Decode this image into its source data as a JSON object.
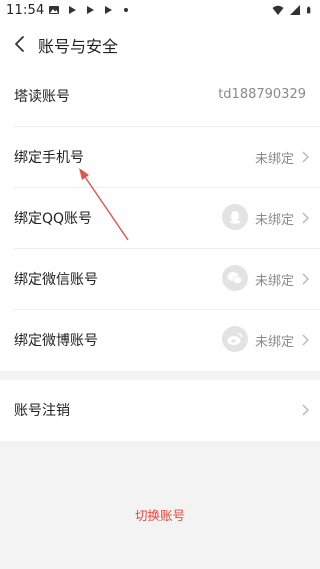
{
  "status_bar": {
    "time": "11:54",
    "left_icons": [
      "image-icon",
      "play-icon",
      "play-icon",
      "play-icon",
      "dot-icon"
    ],
    "right_icons": [
      "wifi-icon",
      "signal-icon",
      "battery-icon"
    ]
  },
  "header": {
    "title": "账号与安全",
    "back_icon": "chevron-left-icon"
  },
  "rows": [
    {
      "label": "塔读账号",
      "value": "td188790329"
    },
    {
      "label": "绑定手机号",
      "status": "未绑定"
    },
    {
      "label": "绑定QQ账号",
      "status": "未绑定",
      "icon": "qq-icon"
    },
    {
      "label": "绑定微信账号",
      "status": "未绑定",
      "icon": "wechat-icon"
    },
    {
      "label": "绑定微博账号",
      "status": "未绑定",
      "icon": "weibo-icon"
    }
  ],
  "account_cancel": {
    "label": "账号注销"
  },
  "switch_account": {
    "label": "切换账号"
  },
  "colors": {
    "accent_red": "#e8453c",
    "annotation_arrow": "#e05550",
    "background": "#f3f3f3",
    "secondary_text": "#8a8a8a"
  }
}
